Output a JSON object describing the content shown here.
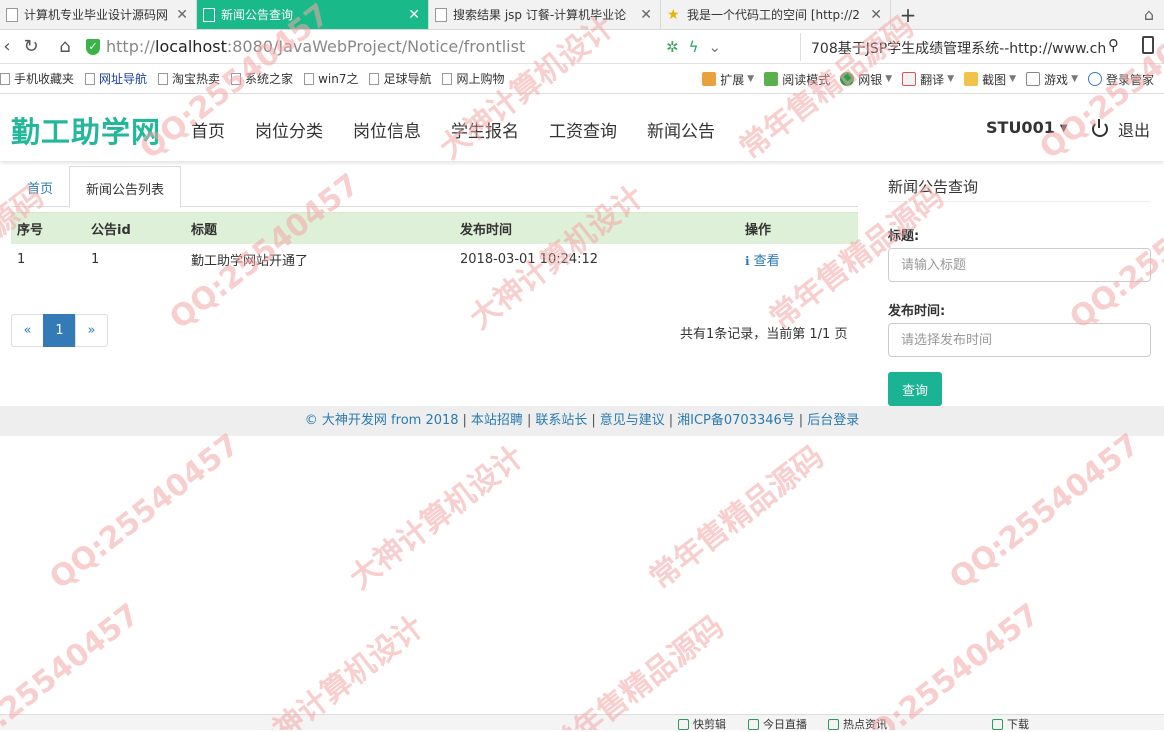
{
  "browser": {
    "tabs": [
      {
        "title": "计算机专业毕业设计源码网"
      },
      {
        "title": "新闻公告查询"
      },
      {
        "title": "搜索结果 jsp 订餐-计算机毕业论"
      },
      {
        "title": "我是一个代码工的空间 [http://2"
      }
    ],
    "new_tab": "+",
    "address": {
      "scheme": "http://",
      "host": "localhost",
      "path": ":8080/JavaWebProject/Notice/frontlist"
    },
    "search_text": "708基于JSP学生成绩管理系统--http://www.ch",
    "bookmarks": [
      {
        "label": "手机收藏夹"
      },
      {
        "label": "网址导航"
      },
      {
        "label": "淘宝热卖"
      },
      {
        "label": "系统之家"
      },
      {
        "label": "win7之"
      },
      {
        "label": "足球导航"
      },
      {
        "label": "网上购物"
      }
    ],
    "tools": [
      {
        "label": "扩展"
      },
      {
        "label": "阅读模式"
      },
      {
        "label": "网银"
      },
      {
        "label": "翻译"
      },
      {
        "label": "截图"
      },
      {
        "label": "游戏"
      },
      {
        "label": "登录管家"
      }
    ],
    "status": [
      "快剪辑",
      "今日直播",
      "热点资讯",
      "下载"
    ]
  },
  "site": {
    "logo": "勤工助学网",
    "nav": [
      "首页",
      "岗位分类",
      "岗位信息",
      "学生报名",
      "工资查询",
      "新闻公告"
    ],
    "user": "STU001",
    "logout": "退出"
  },
  "content": {
    "tabs": [
      "首页",
      "新闻公告列表"
    ],
    "table": {
      "headers": [
        "序号",
        "公告id",
        "标题",
        "发布时间",
        "操作"
      ],
      "rows": [
        {
          "no": "1",
          "id": "1",
          "title": "勤工助学网站开通了",
          "time": "2018-03-01 10:24:12",
          "action": "查看"
        }
      ]
    },
    "pagination": {
      "prev": "«",
      "current": "1",
      "next": "»"
    },
    "summary": "共有1条记录，当前第 1/1 页"
  },
  "sidebar": {
    "title": "新闻公告查询",
    "title_label": "标题:",
    "title_placeholder": "请输入标题",
    "time_label": "发布时间:",
    "time_placeholder": "请选择发布时间",
    "query_button": "查询"
  },
  "footer": {
    "copyright": "© 大神开发网 from 2018",
    "links": [
      "本站招聘",
      "联系站长",
      "意见与建议",
      "湘ICP备0703346号",
      "后台登录"
    ]
  },
  "watermark": {
    "lines": [
      "常年售精品源码",
      "QQ:25540457",
      "大神计算机设计"
    ],
    "color": "#f2a6a6"
  }
}
